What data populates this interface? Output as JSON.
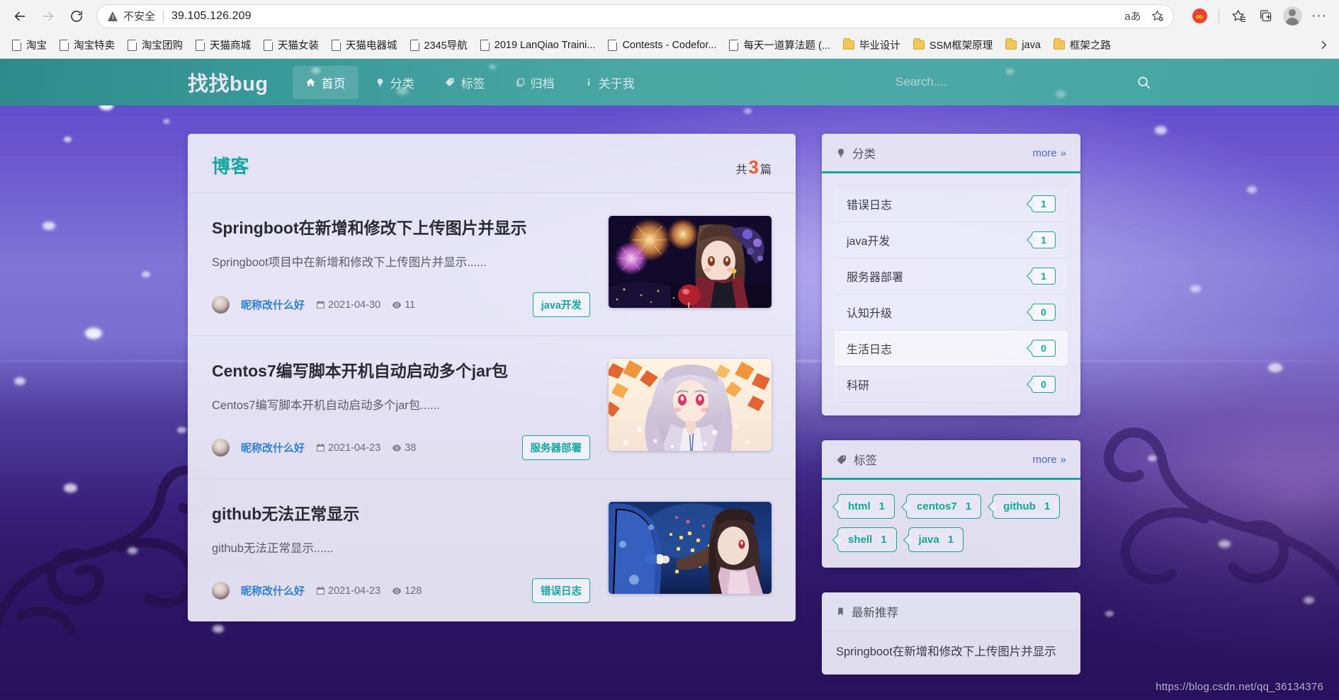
{
  "browser": {
    "back_label": "Back",
    "forward_label": "Forward",
    "reload_label": "Refresh",
    "security_label": "不安全",
    "url": "39.105.126.209",
    "omnibox_icons": [
      {
        "name": "read-aloud-icon",
        "glyph": "aあ"
      },
      {
        "name": "add-favorite-icon",
        "glyph": "☆"
      }
    ],
    "toolbar_icons": [
      {
        "name": "extension-icon",
        "glyph": "∞"
      },
      {
        "name": "favorites-icon",
        "glyph": "☆"
      },
      {
        "name": "collections-icon",
        "glyph": "⊞"
      },
      {
        "name": "profile-avatar",
        "glyph": ""
      },
      {
        "name": "settings-more-icon",
        "glyph": "···"
      }
    ],
    "bookmarks": [
      {
        "label": "淘宝",
        "type": "page"
      },
      {
        "label": "淘宝特卖",
        "type": "page"
      },
      {
        "label": "淘宝团购",
        "type": "page"
      },
      {
        "label": "天猫商城",
        "type": "page"
      },
      {
        "label": "天猫女装",
        "type": "page"
      },
      {
        "label": "天猫电器城",
        "type": "page"
      },
      {
        "label": "2345导航",
        "type": "page"
      },
      {
        "label": "2019 LanQiao Traini...",
        "type": "page"
      },
      {
        "label": "Contests - Codefor...",
        "type": "page"
      },
      {
        "label": "每天一道算法题 (...",
        "type": "page"
      },
      {
        "label": "毕业设计",
        "type": "folder"
      },
      {
        "label": "SSM框架原理",
        "type": "folder"
      },
      {
        "label": "java",
        "type": "folder"
      },
      {
        "label": "框架之路",
        "type": "folder"
      }
    ],
    "bookmark_overflow": "»"
  },
  "site": {
    "brand": "找找bug",
    "nav": [
      {
        "label": "首页",
        "icon": "home-icon",
        "glyph": "⌂",
        "active": true
      },
      {
        "label": "分类",
        "icon": "lightbulb-icon",
        "glyph": "♀",
        "active": false
      },
      {
        "label": "标签",
        "icon": "tag-icon",
        "glyph": "🏷",
        "active": false
      },
      {
        "label": "归档",
        "icon": "copy-icon",
        "glyph": "❐",
        "active": false
      },
      {
        "label": "关于我",
        "icon": "info-icon",
        "glyph": "i",
        "active": false
      }
    ],
    "search": {
      "placeholder": "Search....",
      "value": "",
      "icon": "search-icon"
    }
  },
  "main": {
    "section_title": "博客",
    "count_prefix": "共",
    "count": "3",
    "count_suffix": "篇",
    "posts": [
      {
        "title": "Springboot在新增和修改下上传图片并显示",
        "desc": "Springboot项目中在新增和修改下上传图片并显示......",
        "author": "昵称改什么好",
        "date": "2021-04-30",
        "views": "11",
        "tag": "java开发",
        "thumb": "anime-fireworks-girl"
      },
      {
        "title": "Centos7编写脚本开机自动启动多个jar包",
        "desc": "Centos7编写脚本开机自动启动多个jar包......",
        "author": "昵称改什么好",
        "date": "2021-04-23",
        "views": "38",
        "tag": "服务器部署",
        "thumb": "anime-autumn-girl"
      },
      {
        "title": "github无法正常显示",
        "desc": "github无法正常显示......",
        "author": "昵称改什么好",
        "date": "2021-04-23",
        "views": "128",
        "tag": "错误日志",
        "thumb": "anime-night-couple"
      }
    ]
  },
  "sidebar": {
    "categories": {
      "title": "分类",
      "icon": "lightbulb-icon",
      "more_label": "more",
      "more_glyph": "»",
      "items": [
        {
          "name": "错误日志",
          "count": "1"
        },
        {
          "name": "java开发",
          "count": "1"
        },
        {
          "name": "服务器部署",
          "count": "1"
        },
        {
          "name": "认知升级",
          "count": "0"
        },
        {
          "name": "生活日志",
          "count": "0"
        },
        {
          "name": "科研",
          "count": "0"
        }
      ]
    },
    "tags": {
      "title": "标签",
      "icon": "tag-icon",
      "more_label": "more",
      "more_glyph": "»",
      "items": [
        {
          "name": "html",
          "count": "1"
        },
        {
          "name": "centos7",
          "count": "1"
        },
        {
          "name": "github",
          "count": "1"
        },
        {
          "name": "shell",
          "count": "1"
        },
        {
          "name": "java",
          "count": "1"
        }
      ]
    },
    "recommend": {
      "title": "最新推荐",
      "icon": "bookmark-icon",
      "items": [
        {
          "title": "Springboot在新增和修改下上传图片并显示"
        }
      ]
    }
  },
  "watermark": "https://blog.csdn.net/qq_36134376",
  "colors": {
    "nav_teal": "#4aa7a4",
    "accent_teal": "#14a69c",
    "accent_orange": "#f05a28",
    "link_blue": "#2f7fd0",
    "bg_purple": "#5b46c9"
  }
}
